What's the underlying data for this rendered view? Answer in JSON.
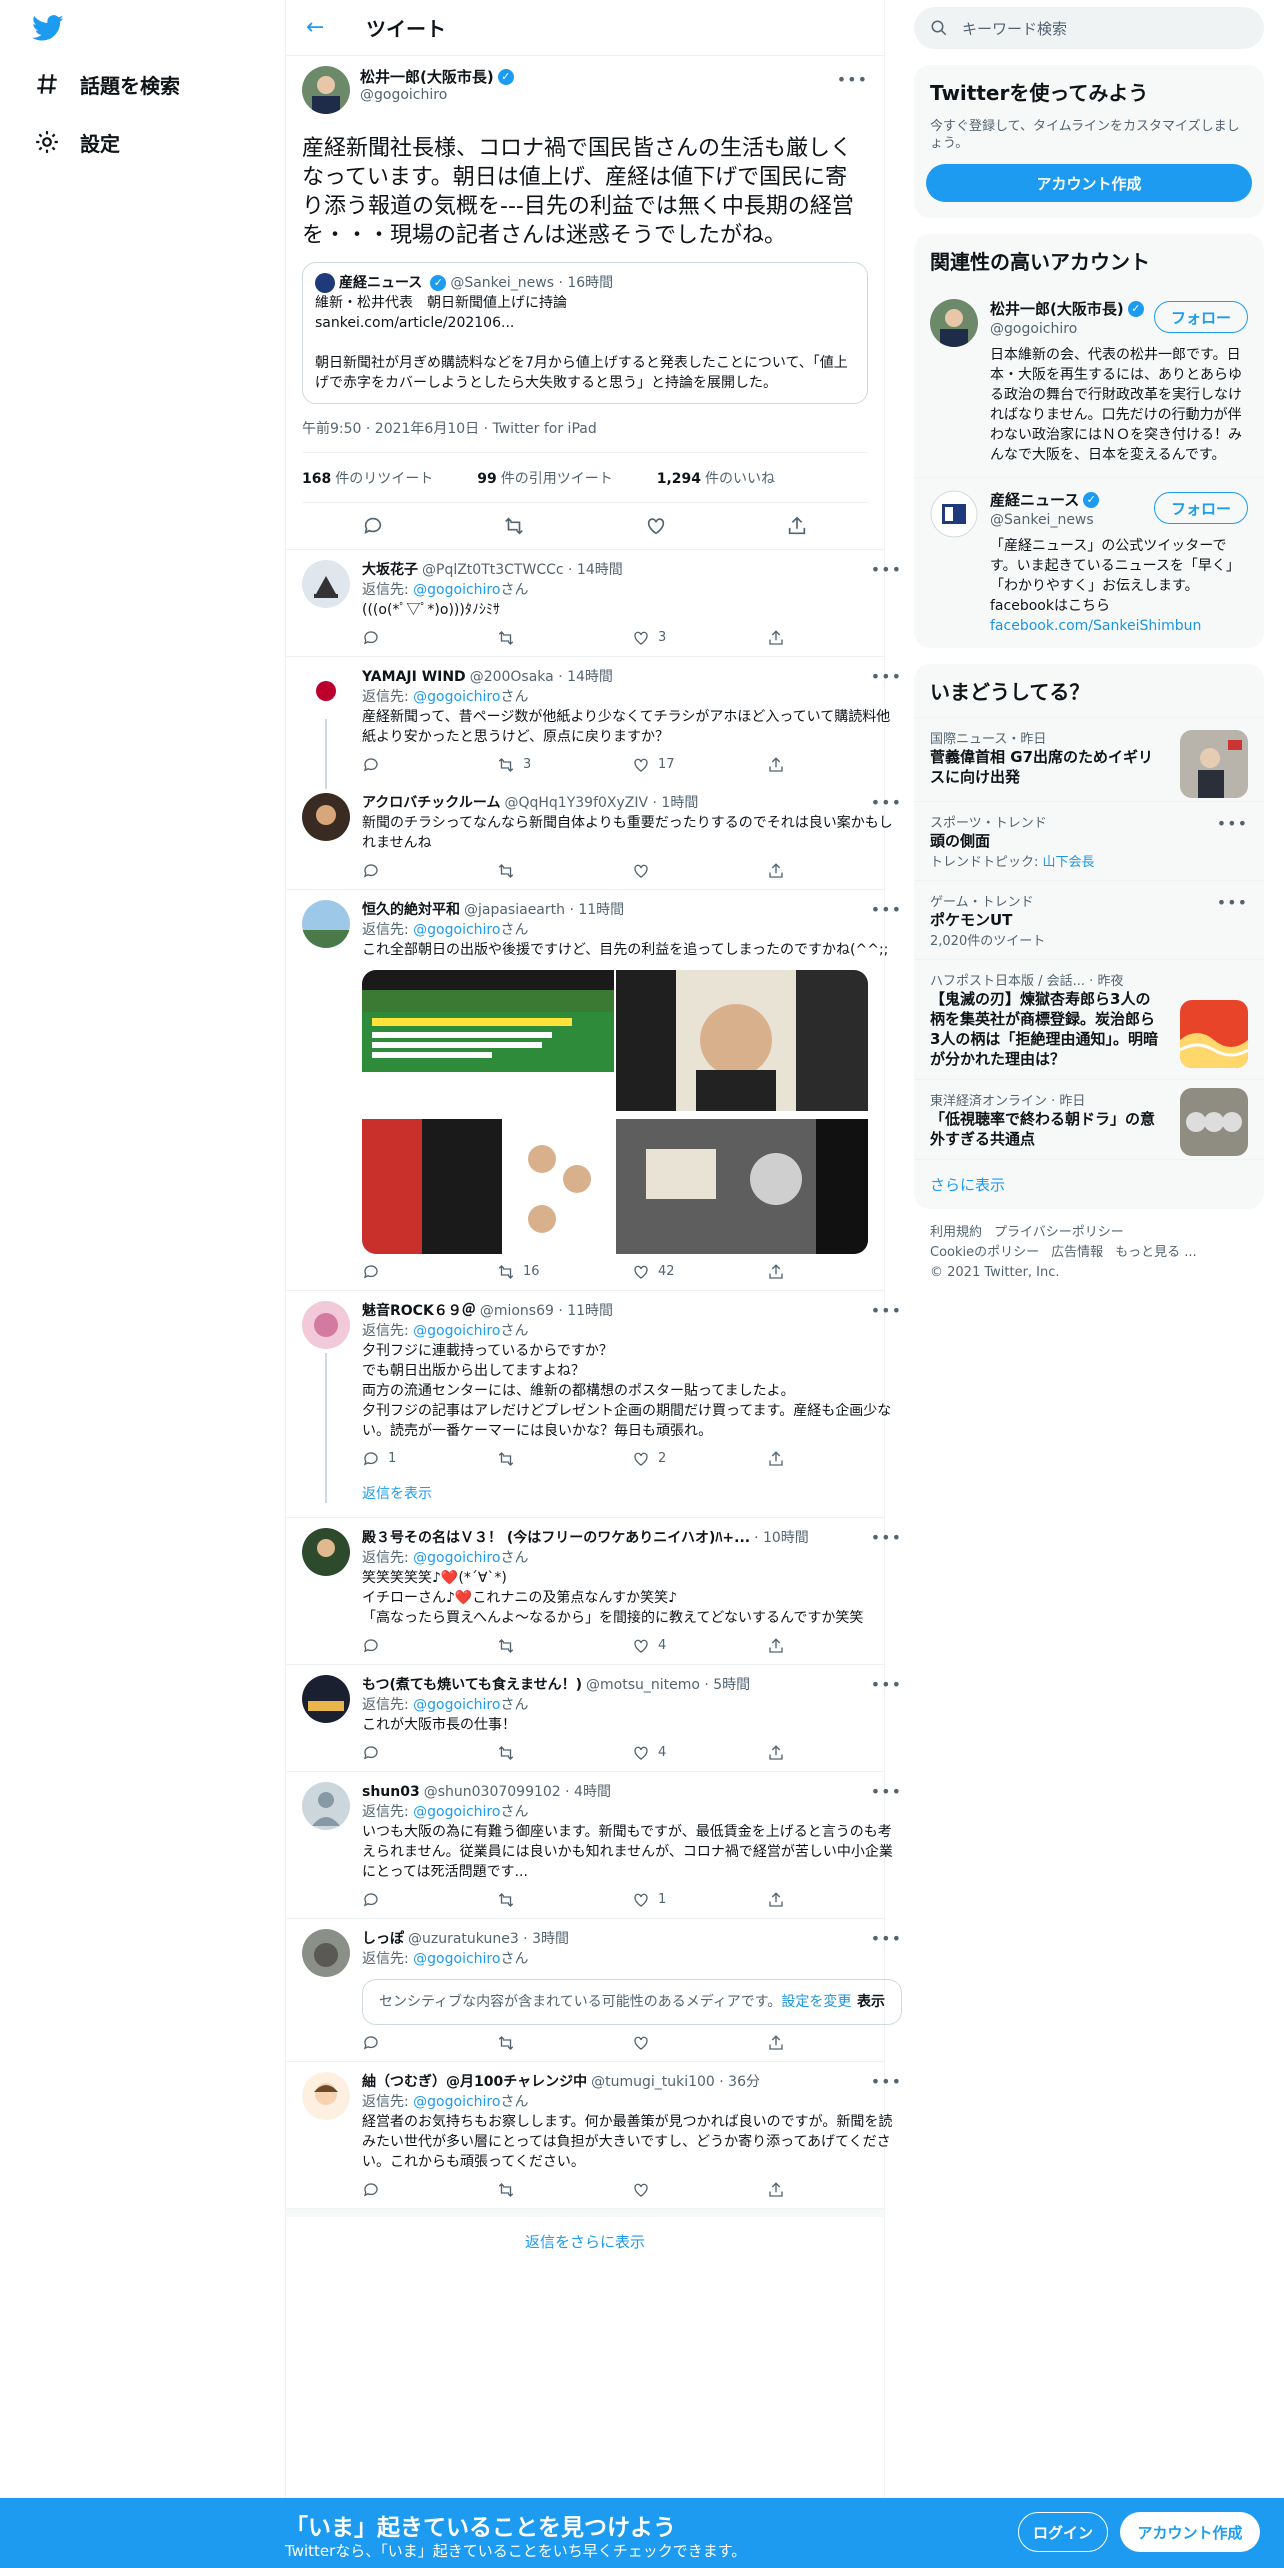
{
  "nav": {
    "explore_label": "話題を検索",
    "settings_label": "設定"
  },
  "header": {
    "title": "ツイート"
  },
  "main_tweet": {
    "author_name": "松井一郎(大阪市長)",
    "handle": "@gogoichiro",
    "text": "産経新聞社長様、コロナ禍で国民皆さんの生活も厳しくなっています。朝日は値上げ、産経は値下げで国民に寄り添う報道の気概を---目先の利益では無く中長期の経営を・・・現場の記者さんは迷惑そうでしたがね。",
    "quote": {
      "name": "産経ニュース",
      "handle_time": "@Sankei_news · 16時間",
      "line1": "維新・松井代表　朝日新聞値上げに持論",
      "line2": "sankei.com/article/202106...",
      "line3": "朝日新聞社が月ぎめ購読料などを7月から値上げすると発表したことについて、「値上げで赤字をカバーしようとしたら大失敗すると思う」と持論を展開した。"
    },
    "meta": "午前9:50 · 2021年6月10日 · Twitter for iPad",
    "retweets_count": "168",
    "retweets_label": "件のリツイート",
    "quotes_count": "99",
    "quotes_label": "件の引用ツイート",
    "likes_count": "1,294",
    "likes_label": "件のいいね"
  },
  "replies": [
    {
      "name": "大坂花子",
      "handle_time": "@PqlZt0Tt3CTWCCc · 14時間",
      "reply_to_prefix": "返信先: ",
      "reply_to": "@gogoichiro",
      "reply_to_suffix": "さん",
      "text": "(((o(*ﾟ▽ﾟ*)o)))ﾀﾉｼﾐｻ",
      "rt": "",
      "likes": "3"
    },
    {
      "name": "YAMAJI WIND",
      "handle_time": "@200Osaka · 14時間",
      "reply_to_prefix": "返信先: ",
      "reply_to": "@gogoichiro",
      "reply_to_suffix": "さん",
      "text": "産経新聞って、昔ページ数が他紙より少なくてチラシがアホほど入っていて購読料他紙より安かったと思うけど、原点に戻りますか？",
      "rt": "3",
      "likes": "17"
    },
    {
      "name": "アクロバチックルーム",
      "handle_time": "@QqHq1Y39f0XyZIV · 1時間",
      "text": "新聞のチラシってなんなら新聞自体よりも重要だったりするのでそれは良い案かもしれませんね",
      "rt": "",
      "likes": ""
    },
    {
      "name": "恒久的絶対平和",
      "handle_time": "@japasiaearth · 11時間",
      "reply_to_prefix": "返信先: ",
      "reply_to": "@gogoichiro",
      "reply_to_suffix": "さん",
      "text": "これ全部朝日の出版や後援ですけど、目先の利益を追ってしまったのですかね(^^;;",
      "rt": "16",
      "likes": "42"
    },
    {
      "name": "魅音ROCK６９＠",
      "handle_time": "@mions69 · 11時間",
      "reply_to_prefix": "返信先: ",
      "reply_to": "@gogoichiro",
      "reply_to_suffix": "さん",
      "text": "夕刊フジに連載持っているからですか？\nでも朝日出版から出してますよね？\n両方の流通センターには、維新の都構想のポスター貼ってましたよ。\n夕刊フジの記事はアレだけどプレゼント企画の期間だけ買ってます。産経も企画少ない。読売が一番ケーマーには良いかな？毎日も頑張れ。",
      "rt": "",
      "likes": "2",
      "replies_count": "1"
    },
    {
      "name": "殿３号その名はＶ３！ (今はフリーのワケありニイハオ)ﾊ+...",
      "handle_time": "· 10時間",
      "reply_to_prefix": "返信先: ",
      "reply_to": "@gogoichiro",
      "reply_to_suffix": "さん",
      "text": "笑笑笑笑笑♪❤️(*´∀`*)\nイチローさん♪❤️これナニの及第点なんすか笑笑♪\n「高なったら買えへんよ〜なるから」を間接的に教えてどないするんですか笑笑",
      "rt": "",
      "likes": "4"
    },
    {
      "name": "もつ(煮ても焼いても食えません！)",
      "handle_time": "@motsu_nitemo · 5時間",
      "reply_to_prefix": "返信先: ",
      "reply_to": "@gogoichiro",
      "reply_to_suffix": "さん",
      "text": "これが大阪市長の仕事！",
      "rt": "",
      "likes": "4"
    },
    {
      "name": "shun03",
      "handle_time": "@shun0307099102 · 4時間",
      "reply_to_prefix": "返信先: ",
      "reply_to": "@gogoichiro",
      "reply_to_suffix": "さん",
      "text": "いつも大阪の為に有難う御座います。新聞もですが、最低賃金を上げると言うのも考えられません。従業員には良いかも知れませんが、コロナ禍で経営が苦しい中小企業にとっては死活問題です...",
      "rt": "",
      "likes": "1"
    },
    {
      "name": "しっぽ",
      "handle_time": "@uzuratukune3 · 3時間",
      "reply_to_prefix": "返信先: ",
      "reply_to": "@gogoichiro",
      "reply_to_suffix": "さん",
      "sensitive_text": "センシティブな内容が含まれている可能性のあるメディアです。",
      "sensitive_link": "設定を変更",
      "sensitive_btn": "表示",
      "rt": "",
      "likes": ""
    },
    {
      "name": "紬（つむぎ）@月100チャレンジ中",
      "handle_time": "@tumugi_tuki100 · 36分",
      "reply_to_prefix": "返信先: ",
      "reply_to": "@gogoichiro",
      "reply_to_suffix": "さん",
      "text": "経営者のお気持ちもお察しします。何か最善策が見つかれば良いのですが。新聞を読みたい世代が多い層にとっては負担が大きいですし、どうか寄り添ってあげてください。これからも頑張ってください。",
      "rt": "",
      "likes": ""
    }
  ],
  "show_thread_label": "返信を表示",
  "more_replies_label": "返信をさらに表示",
  "sidebar": {
    "search_placeholder": "キーワード検索",
    "join": {
      "title": "Twitterを使ってみよう",
      "subtitle": "今すぐ登録して、タイムラインをカスタマイズしましょう。",
      "button": "アカウント作成"
    },
    "related": {
      "title": "関連性の高いアカウント",
      "accounts": [
        {
          "name": "松井一郎(大阪市長)",
          "handle": "@gogoichiro",
          "follow": "フォロー",
          "bio": "日本維新の会、代表の松井一郎です。日本・大阪を再生するには、ありとあらゆる政治の舞台で行財政改革を実行しなければなりません。口先だけの行動力が伴わない政治家にはＮＯを突き付ける！みんなで大阪を、日本を変えるんです。"
        },
        {
          "name": "産経ニュース",
          "handle": "@Sankei_news",
          "follow": "フォロー",
          "bio": "「産経ニュース」の公式ツイッターです。いま起きているニュースを「早く」「わかりやすく」お伝えします。facebookはこちら",
          "link": "facebook.com/SankeiShimbun"
        }
      ]
    },
    "trends": {
      "title": "いまどうしてる？",
      "items": [
        {
          "category": "国際ニュース・昨日",
          "title": "菅義偉首相 G7出席のためイギリスに向け出発"
        },
        {
          "category": "スポーツ・トレンド",
          "title": "頭の側面",
          "sub_prefix": "トレンドトピック: ",
          "sub_link": "山下会長"
        },
        {
          "category": "ゲーム・トレンド",
          "title": "ポケモンUT",
          "sub": "2,020件のツイート"
        },
        {
          "category": "ハフポスト日本版 / 会話...",
          "category_suffix": " · 昨夜",
          "title": "【鬼滅の刃】煉獄杏寿郎ら3人の柄を集英社が商標登録。炭治郎ら3人の柄は「拒絶理由通知」。明暗が分かれた理由は？"
        },
        {
          "category": "東洋経済オンライン",
          "category_suffix": " · 昨日",
          "title": "「低視聴率で終わる朝ドラ」の意外すぎる共通点"
        }
      ],
      "show_more": "さらに表示"
    },
    "footer": [
      "利用規約",
      "プライバシーポリシー",
      "Cookieのポリシー",
      "広告情報",
      "もっと見る ...",
      "© 2021 Twitter, Inc."
    ]
  },
  "bottom_bar": {
    "title": "「いま」起きていることを見つけよう",
    "subtitle": "Twitterなら、「いま」起きていることをいち早くチェックできます。",
    "login": "ログイン",
    "signup": "アカウント作成"
  },
  "colors": {
    "accent": "#1d9bf0",
    "text": "#0f1419",
    "muted": "#536471",
    "like_heart": "#f91880"
  }
}
